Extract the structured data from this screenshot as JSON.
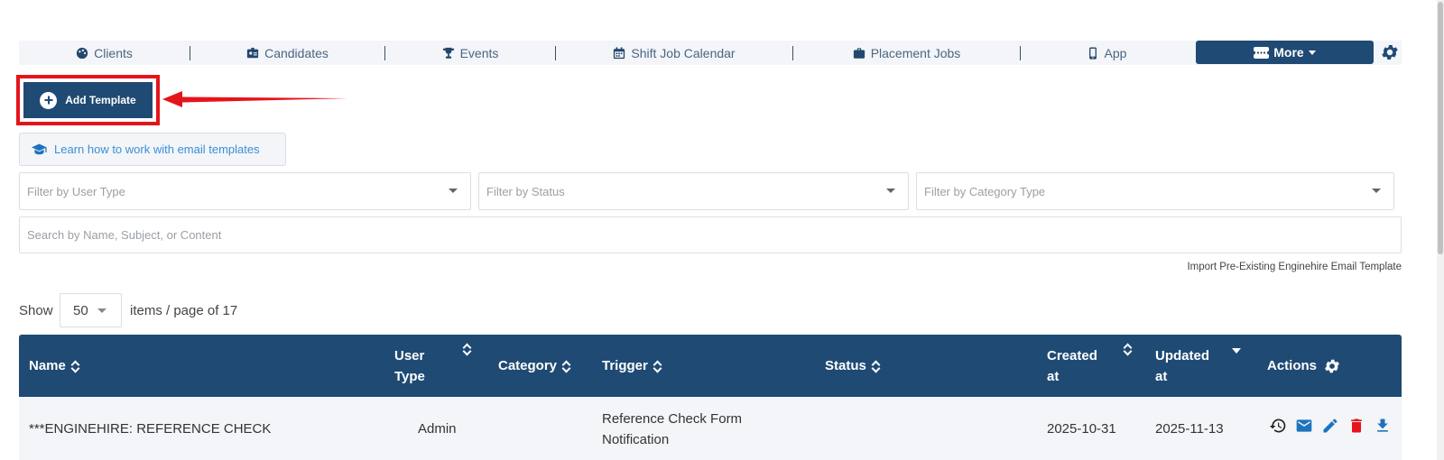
{
  "nav": {
    "items": [
      {
        "label": "Clients",
        "icon": "palette-icon"
      },
      {
        "label": "Candidates",
        "icon": "id-badge-icon"
      },
      {
        "label": "Events",
        "icon": "trophy-icon"
      },
      {
        "label": "Shift Job Calendar",
        "icon": "calendar-icon"
      },
      {
        "label": "Placement Jobs",
        "icon": "briefcase-icon"
      },
      {
        "label": "App",
        "icon": "mobile-icon"
      }
    ],
    "more_label": "More"
  },
  "toolbar": {
    "add_template_label": "Add Template",
    "learn_label": "Learn how to work with email templates",
    "import_label": "Import Pre-Existing Enginehire Email Template"
  },
  "filters": {
    "user_type_placeholder": "Filter by User Type",
    "status_placeholder": "Filter by Status",
    "category_placeholder": "Filter by Category Type",
    "search_placeholder": "Search by Name, Subject, or Content"
  },
  "pager": {
    "show_label": "Show",
    "page_size": "50",
    "items_label": "items / page of 17"
  },
  "table": {
    "columns": {
      "name": "Name",
      "user_type_1": "User",
      "user_type_2": "Type",
      "category": "Category",
      "trigger": "Trigger",
      "status": "Status",
      "created_1": "Created",
      "created_2": "at",
      "updated_1": "Updated",
      "updated_2": "at",
      "actions": "Actions"
    },
    "rows": [
      {
        "name": "***ENGINEHIRE: REFERENCE CHECK",
        "user_type": "Admin",
        "category": "",
        "trigger_1": "Reference Check Form",
        "trigger_2": "Notification",
        "status": "",
        "created": "2025-10-31",
        "updated": "2025-11-13"
      }
    ]
  },
  "colors": {
    "primary": "#1f4a73",
    "highlight_red": "#e5141b",
    "link_blue": "#3b8fd9",
    "delete_red": "#e5141b",
    "action_blue": "#1e73be"
  }
}
